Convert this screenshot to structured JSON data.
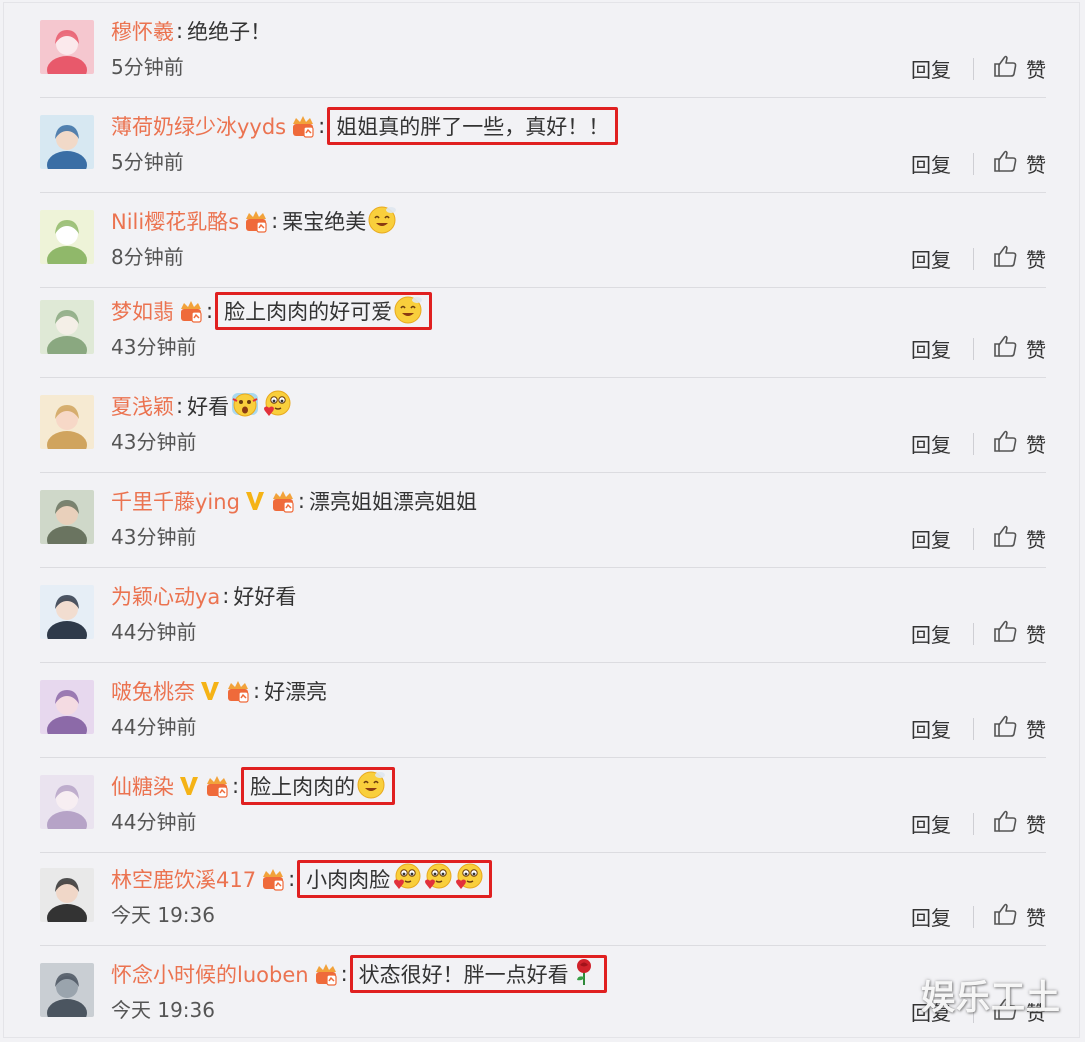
{
  "labels": {
    "reply": "回复",
    "like": "赞"
  },
  "colors": {
    "username": "#eb7350",
    "highlight_box": "#e02020",
    "background": "#f2f2f5"
  },
  "comments": [
    {
      "username": "穆怀羲",
      "badges": [],
      "text": "绝绝子！",
      "emojis": [],
      "time": "5分钟前",
      "boxed": false
    },
    {
      "username": "薄荷奶绿少冰yyds",
      "badges": [
        "fan-crown-icon"
      ],
      "text": "姐姐真的胖了一些，真好！！",
      "emojis": [],
      "time": "5分钟前",
      "boxed": true
    },
    {
      "username": "Nili樱花乳酪s",
      "badges": [
        "fan-crown-icon"
      ],
      "text": "栗宝绝美",
      "emojis": [
        "drool-emoji-icon"
      ],
      "time": "8分钟前",
      "boxed": false
    },
    {
      "username": "梦如翡",
      "badges": [
        "fan-crown-icon"
      ],
      "text": "脸上肉肉的好可爱",
      "emojis": [
        "drool-emoji-icon"
      ],
      "time": "43分钟前",
      "boxed": true
    },
    {
      "username": "夏浅颖",
      "badges": [],
      "text": "好看",
      "emojis": [
        "scream-emoji-icon",
        "love-emoji-icon"
      ],
      "time": "43分钟前",
      "boxed": false
    },
    {
      "username": "千里千藤ying",
      "badges": [
        "verified-v-icon",
        "fan-crown-icon"
      ],
      "text": "漂亮姐姐漂亮姐姐",
      "emojis": [],
      "time": "43分钟前",
      "boxed": false
    },
    {
      "username": "为颖心动ya",
      "badges": [],
      "text": "好好看",
      "emojis": [],
      "time": "44分钟前",
      "boxed": false
    },
    {
      "username": "啵兔桃奈",
      "badges": [
        "verified-v-icon",
        "fan-crown-icon"
      ],
      "text": "好漂亮",
      "emojis": [],
      "time": "44分钟前",
      "boxed": false
    },
    {
      "username": "仙糖染",
      "badges": [
        "verified-v-icon",
        "fan-crown-icon"
      ],
      "text": "脸上肉肉的",
      "emojis": [
        "drool-emoji-icon"
      ],
      "time": "44分钟前",
      "boxed": true
    },
    {
      "username": "林空鹿饮溪417",
      "badges": [
        "fan-crown-icon"
      ],
      "text": "小肉肉脸",
      "emojis": [
        "love-emoji-icon",
        "love-emoji-icon",
        "love-emoji-icon"
      ],
      "time": "今天 19:36",
      "boxed": true
    },
    {
      "username": "怀念小时候的luoben",
      "badges": [
        "fan-crown-icon"
      ],
      "text": "状态很好！胖一点好看",
      "emojis": [
        "rose-emoji-icon"
      ],
      "time": "今天 19:36",
      "boxed": true
    }
  ],
  "watermark": "娱乐工土"
}
